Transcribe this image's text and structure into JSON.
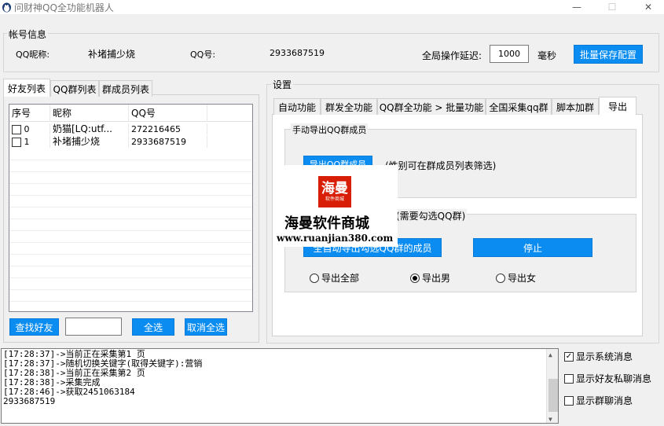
{
  "window": {
    "title": "问财神QQ全功能机器人",
    "min_glyph": "—",
    "max_glyph": "☐",
    "close_glyph": "✕"
  },
  "account": {
    "group_title": "帐号信息",
    "nickname_label": "QQ昵称:",
    "nickname_value": "补堵捕少烧",
    "qq_label": "QQ号:",
    "qq_value": "2933687519",
    "delay_label": "全局操作延迟:",
    "delay_value": "1000",
    "delay_unit": "毫秒",
    "save_button": "批量保存配置"
  },
  "left_tabs": [
    "好友列表",
    "QQ群列表",
    "群成员列表"
  ],
  "friend_table": {
    "headers": [
      "序号",
      "昵称",
      "QQ号"
    ],
    "rows": [
      {
        "index": "0",
        "nickname": "奶猫[LQ:utf...",
        "qq": "272216465"
      },
      {
        "index": "1",
        "nickname": "补堵捕少烧",
        "qq": "2933687519"
      }
    ]
  },
  "left_buttons": {
    "find_friend": "查找好友",
    "search_value": "",
    "select_all": "全选",
    "deselect_all": "取消全选"
  },
  "settings": {
    "group_title": "设置",
    "tabs": [
      "自动功能",
      "群发全功能",
      "QQ群全功能 > 批量功能",
      "全国采集qq群",
      "脚本加群",
      "导出"
    ],
    "active_tab": "导出",
    "manual_export": {
      "title": "手动导出QQ群成员",
      "button": "导出QQ群成员",
      "hint": "(性别可在群成员列表筛选)"
    },
    "auto_export": {
      "title_suffix": "(需要勾选QQ群)",
      "start_button": "全自动导出勾选QQ群的成员",
      "stop_button": "停止",
      "radios": [
        {
          "label": "导出全部",
          "checked": false
        },
        {
          "label": "导出男",
          "checked": true
        },
        {
          "label": "导出女",
          "checked": false
        }
      ]
    }
  },
  "watermark": {
    "logo_text": "海曼",
    "logo_sub": "软件商城",
    "name": "海曼软件商城",
    "url": "www.ruanjian380.com"
  },
  "log": [
    "[17:28:37]->当前正在采集第1 页",
    "[17:28:37]->随机切换关键字(取得关键字):营销",
    "[17:28:38]->当前正在采集第2 页",
    "[17:28:38]->采集完成",
    "[17:28:46]->获取2451063184",
    "2933687519"
  ],
  "options": [
    {
      "label": "显示系统消息",
      "checked": true
    },
    {
      "label": "显示好友私聊消息",
      "checked": false
    },
    {
      "label": "显示群聊消息",
      "checked": false
    }
  ],
  "colors": {
    "button_blue": "#0a8cf0",
    "watermark_red": "#d81e06"
  }
}
